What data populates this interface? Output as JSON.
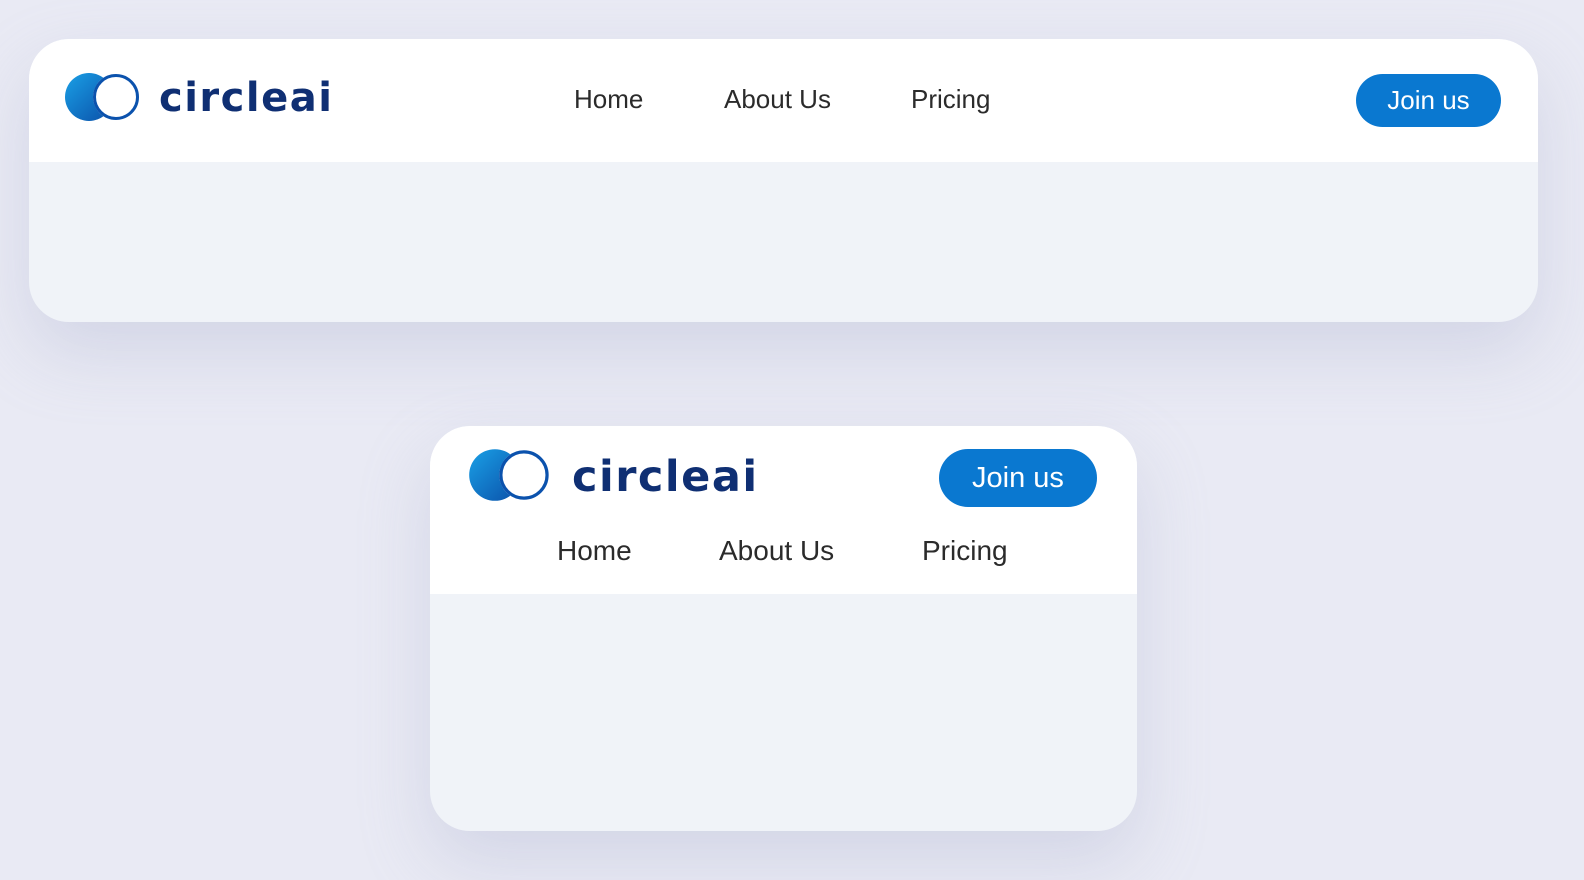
{
  "brand": {
    "name": "circleai"
  },
  "nav": {
    "items": [
      {
        "label": "Home"
      },
      {
        "label": "About Us"
      },
      {
        "label": "Pricing"
      }
    ]
  },
  "cta": {
    "label": "Join us"
  },
  "colors": {
    "brand_text": "#0f2f73",
    "accent": "#0a78d0",
    "logo_gradient_start": "#1a9be0",
    "logo_gradient_end": "#0a4fa8",
    "navbar_bg": "#ffffff",
    "card_body_bg": "#f0f3f8",
    "page_bg": "#e9eaf4"
  },
  "icons": {
    "logo": "overlapping-circles-logo-icon"
  }
}
